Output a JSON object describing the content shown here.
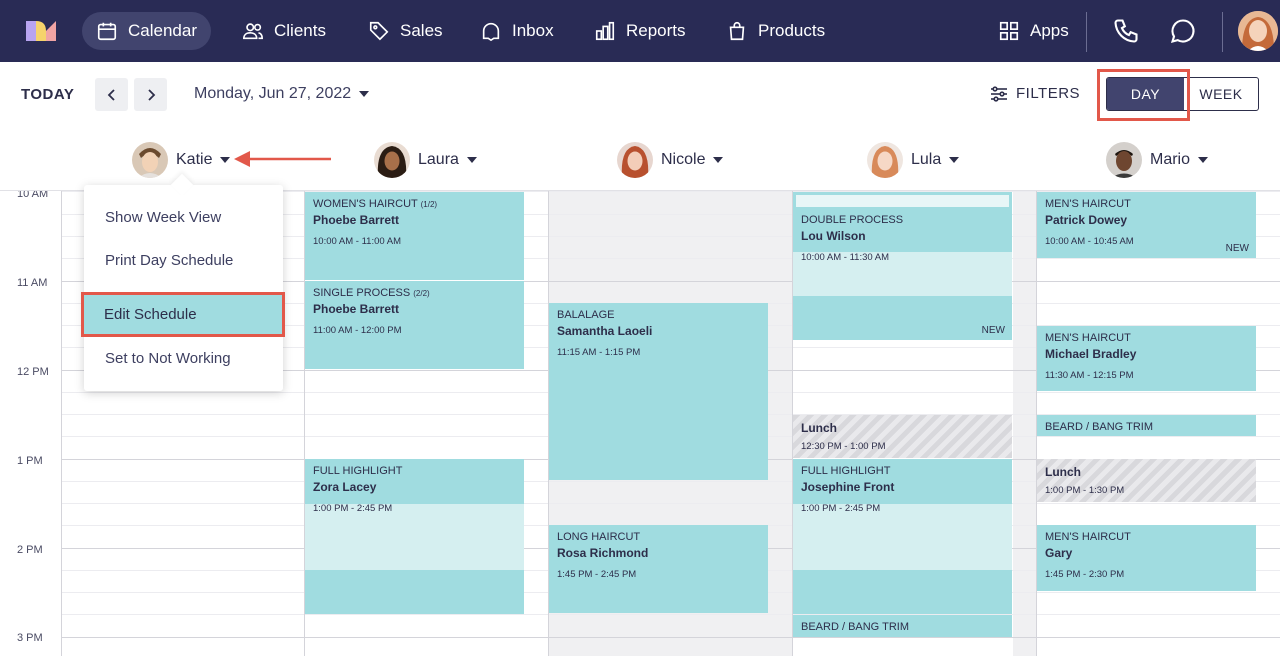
{
  "nav": {
    "items": [
      {
        "label": "Calendar",
        "icon": "calendar-icon",
        "active": true
      },
      {
        "label": "Clients",
        "icon": "clients-icon"
      },
      {
        "label": "Sales",
        "icon": "tag-icon"
      },
      {
        "label": "Inbox",
        "icon": "inbox-icon"
      },
      {
        "label": "Reports",
        "icon": "reports-icon"
      },
      {
        "label": "Products",
        "icon": "bag-icon"
      }
    ],
    "apps_label": "Apps"
  },
  "toolbar": {
    "today_label": "TODAY",
    "date_label": "Monday, Jun 27, 2022",
    "filters_label": "FILTERS",
    "day_label": "DAY",
    "week_label": "WEEK"
  },
  "staff": [
    {
      "name": "Katie"
    },
    {
      "name": "Laura"
    },
    {
      "name": "Nicole"
    },
    {
      "name": "Lula"
    },
    {
      "name": "Mario"
    }
  ],
  "times": [
    "10 AM",
    "11 AM",
    "12 PM",
    "1 PM",
    "2 PM",
    "3 PM"
  ],
  "menu": {
    "items": [
      "Show Week View",
      "Print Day Schedule",
      "Edit Schedule",
      "Set to Not Working"
    ]
  },
  "appointments": {
    "laura": [
      {
        "service": "WOMEN'S HAIRCUT",
        "tag": "(1/2)",
        "client": "Phoebe Barrett",
        "time": "10:00 AM - 11:00 AM"
      },
      {
        "service": "SINGLE PROCESS",
        "tag": "(2/2)",
        "client": "Phoebe Barrett",
        "time": "11:00 AM - 12:00 PM"
      },
      {
        "service": "FULL HIGHLIGHT",
        "client": "Zora Lacey",
        "time": "1:00 PM - 2:45 PM"
      }
    ],
    "nicole": [
      {
        "service": "BALALAGE",
        "client": "Samantha Laoeli",
        "time": "11:15 AM - 1:15 PM"
      },
      {
        "service": "LONG HAIRCUT",
        "client": "Rosa Richmond",
        "time": "1:45 PM - 2:45 PM"
      }
    ],
    "lula": [
      {
        "service": "DOUBLE PROCESS",
        "client": "Lou Wilson",
        "time": "10:00 AM - 11:30 AM",
        "badge": "NEW"
      },
      {
        "client": "Lunch",
        "time": "12:30 PM - 1:00 PM"
      },
      {
        "service": "FULL HIGHLIGHT",
        "client": "Josephine Front",
        "time": "1:00 PM - 2:45 PM"
      },
      {
        "service": "BEARD / BANG TRIM"
      }
    ],
    "mario": [
      {
        "service": "MEN'S HAIRCUT",
        "client": "Patrick Dowey",
        "time": "10:00 AM - 10:45 AM",
        "badge": "NEW"
      },
      {
        "service": "MEN'S HAIRCUT",
        "client": "Michael Bradley",
        "time": "11:30 AM - 12:15 PM"
      },
      {
        "service": "BEARD / BANG TRIM"
      },
      {
        "client": "Lunch",
        "time": "1:00 PM - 1:30 PM"
      },
      {
        "service": "MEN'S HAIRCUT",
        "client": "Gary",
        "time": "1:45 PM - 2:30 PM"
      }
    ]
  },
  "colors": {
    "nav_bg": "#292b55",
    "appointment": "#a0dce0",
    "highlight_outline": "#e2584a"
  }
}
